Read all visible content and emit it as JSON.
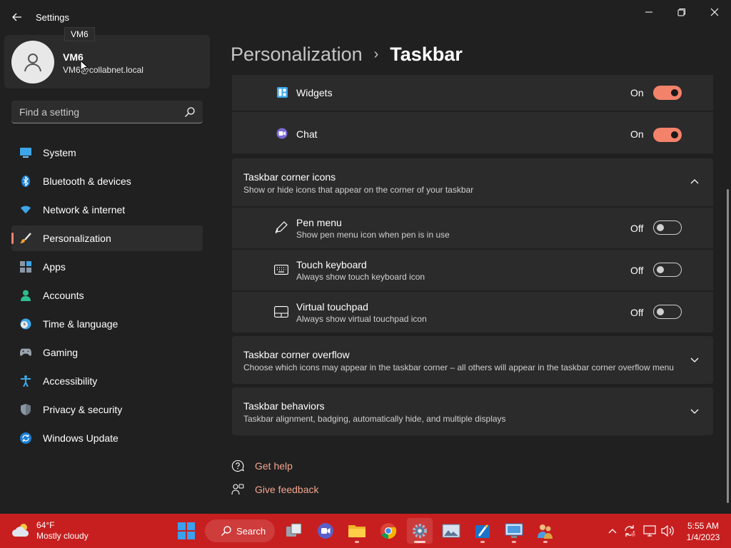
{
  "window": {
    "app_title": "Settings",
    "tooltip": "VM6"
  },
  "profile": {
    "name": "VM6",
    "email": "VM6@collabnet.local"
  },
  "search": {
    "placeholder": "Find a setting"
  },
  "sidebar": {
    "accent_color": "#f3826a",
    "items": [
      {
        "label": "System",
        "icon": "system-icon"
      },
      {
        "label": "Bluetooth & devices",
        "icon": "bluetooth-icon"
      },
      {
        "label": "Network & internet",
        "icon": "wifi-icon"
      },
      {
        "label": "Personalization",
        "icon": "brush-icon",
        "active": true
      },
      {
        "label": "Apps",
        "icon": "apps-icon"
      },
      {
        "label": "Accounts",
        "icon": "accounts-icon"
      },
      {
        "label": "Time & language",
        "icon": "clock-globe-icon"
      },
      {
        "label": "Gaming",
        "icon": "gamepad-icon"
      },
      {
        "label": "Accessibility",
        "icon": "accessibility-icon"
      },
      {
        "label": "Privacy & security",
        "icon": "shield-icon"
      },
      {
        "label": "Windows Update",
        "icon": "update-icon"
      }
    ]
  },
  "breadcrumb": {
    "parent": "Personalization",
    "separator": "›",
    "current": "Taskbar"
  },
  "taskbar_items": {
    "widgets": {
      "label": "Widgets",
      "state": "On",
      "enabled": true,
      "icon": "widgets-icon"
    },
    "chat": {
      "label": "Chat",
      "state": "On",
      "enabled": true,
      "icon": "chat-icon"
    }
  },
  "corner_icons": {
    "title": "Taskbar corner icons",
    "subtitle": "Show or hide icons that appear on the corner of your taskbar",
    "expanded": true,
    "items": {
      "pen": {
        "title": "Pen menu",
        "subtitle": "Show pen menu icon when pen is in use",
        "state": "Off",
        "enabled": false,
        "icon": "pen-icon"
      },
      "keyboard": {
        "title": "Touch keyboard",
        "subtitle": "Always show touch keyboard icon",
        "state": "Off",
        "enabled": false,
        "icon": "keyboard-icon"
      },
      "touchpad": {
        "title": "Virtual touchpad",
        "subtitle": "Always show virtual touchpad icon",
        "state": "Off",
        "enabled": false,
        "icon": "touchpad-icon"
      }
    }
  },
  "corner_overflow": {
    "title": "Taskbar corner overflow",
    "subtitle": "Choose which icons may appear in the taskbar corner – all others will appear in the taskbar corner overflow menu"
  },
  "behaviors": {
    "title": "Taskbar behaviors",
    "subtitle": "Taskbar alignment, badging, automatically hide, and multiple displays"
  },
  "links": {
    "help": "Get help",
    "feedback": "Give feedback"
  },
  "system_taskbar": {
    "color": "#c71f1f",
    "weather": {
      "temp": "64°F",
      "condition": "Mostly cloudy"
    },
    "search_label": "Search",
    "clock": {
      "time": "5:55 AM",
      "date": "1/4/2023"
    }
  }
}
